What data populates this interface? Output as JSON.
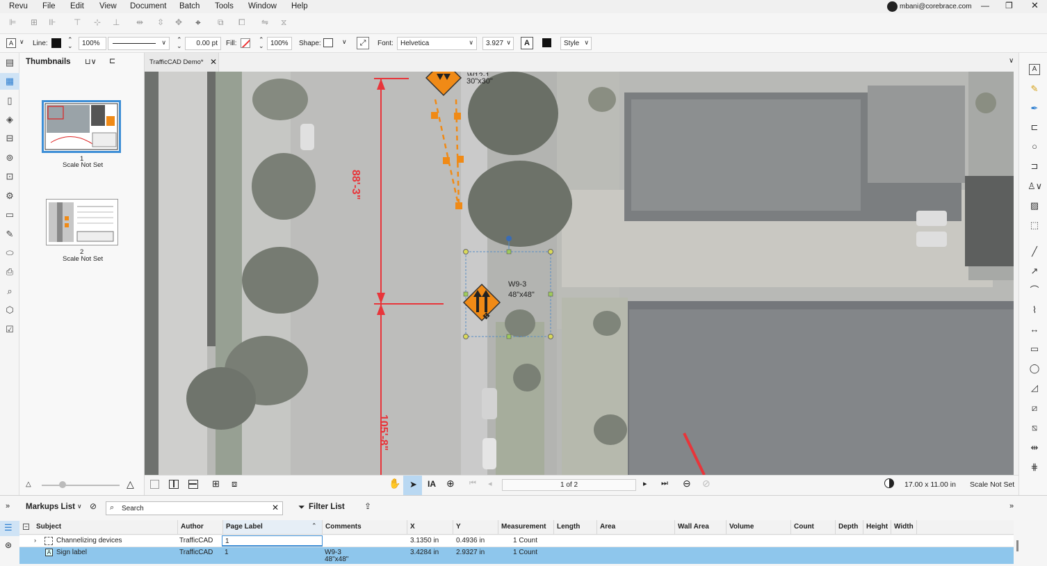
{
  "menubar": {
    "items": [
      "Revu",
      "File",
      "Edit",
      "View",
      "Document",
      "Batch",
      "Tools",
      "Window",
      "Help"
    ],
    "user": "mbani@corebrace.com"
  },
  "props_toolbar": {
    "text_icon": "A",
    "line_label": "Line:",
    "line_opacity": "100%",
    "line_width": "0.00 pt",
    "fill_label": "Fill:",
    "fill_opacity": "100%",
    "shape_label": "Shape:",
    "font_label": "Font:",
    "font_value": "Helvetica",
    "font_size": "3.927",
    "style_label": "Style"
  },
  "thumbnails": {
    "title": "Thumbnails",
    "pages": [
      {
        "number": "1",
        "scale": "Scale Not Set"
      },
      {
        "number": "2",
        "scale": "Scale Not Set"
      }
    ]
  },
  "tab": {
    "label": "TrafficCAD Demo*"
  },
  "drawing": {
    "dim1": "88'-3\"",
    "dim2": "105'-8\"",
    "sign1_code": "W12-1",
    "sign1_size": "30\"x30\"",
    "sign2_code": "W9-3",
    "sign2_size": "48\"x48\""
  },
  "navbar": {
    "page_indicator": "1 of 2",
    "page_size": "17.00 x 11.00 in",
    "scale": "Scale Not Set"
  },
  "markups": {
    "title": "Markups List",
    "search_placeholder": "Search",
    "filter_label": "Filter List",
    "columns": [
      "Subject",
      "Author",
      "Page Label",
      "Comments",
      "X",
      "Y",
      "Measurement",
      "Length",
      "Area",
      "Wall Area",
      "Volume",
      "Count",
      "Depth",
      "Height",
      "Width"
    ],
    "rows": [
      {
        "subject": "Channelizing devices",
        "author": "TrafficCAD",
        "page_label": "1",
        "comments": "",
        "x": "3.1350 in",
        "y": "0.4936 in",
        "measurement": "1 Count"
      },
      {
        "subject": "Sign label",
        "author": "TrafficCAD",
        "page_label": "1",
        "comments_line1": "W9-3",
        "comments_line2": "48\"x48\"",
        "x": "3.4284 in",
        "y": "2.9327 in",
        "measurement": "1 Count"
      }
    ]
  },
  "colors": {
    "accent": "#3d8ed6",
    "selected_row": "#8ec6ec",
    "dimension_red": "#e8353a",
    "sign_orange": "#f08a16"
  },
  "icons": {
    "left_strip": [
      "document-icon",
      "thumbnails-icon",
      "bookmarks-icon",
      "layers-icon",
      "toolchest-icon",
      "markup-icon",
      "studio-icon",
      "settings-icon",
      "measure-icon",
      "signature-icon",
      "tag-icon",
      "printer-icon",
      "search-icon",
      "spaces-icon",
      "forms-icon"
    ],
    "right_strip": [
      "text-icon",
      "highlighter-icon",
      "pen-icon",
      "callout-icon",
      "cloud-icon",
      "stamp-icon",
      "user-icon",
      "image-icon",
      "snapshot-icon",
      "line-icon",
      "arrow-icon",
      "arc-icon",
      "polyline-icon",
      "dimension-icon",
      "rectangle-icon",
      "ellipse-icon",
      "polygon-icon",
      "area-icon",
      "volume-icon",
      "length-icon",
      "count-icon"
    ]
  }
}
